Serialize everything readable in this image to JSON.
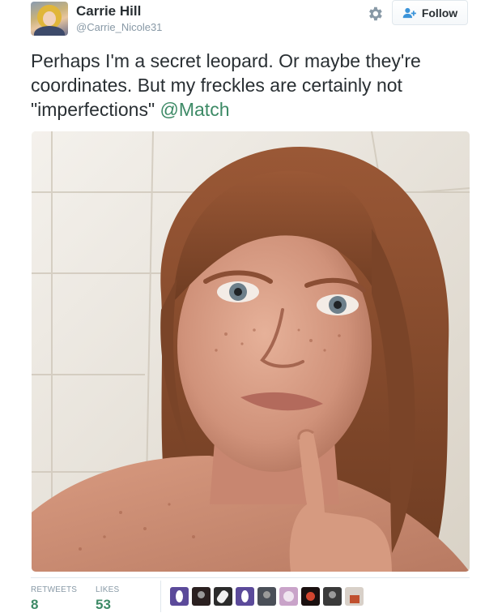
{
  "user": {
    "name": "Carrie Hill",
    "handle": "@Carrie_Nicole31"
  },
  "actions": {
    "follow_label": "Follow"
  },
  "tweet": {
    "text": "Perhaps I'm a secret leopard. Or maybe they're coordinates. But my freckles are certainly not \"imperfections\"",
    "mention": "@Match"
  },
  "stats": {
    "retweets_label": "RETWEETS",
    "retweets_count": "8",
    "likes_label": "LIKES",
    "likes_count": "53"
  },
  "likers": [
    {
      "icon": "oval-avatar-purple",
      "color": "#5b4a9a"
    },
    {
      "icon": "dark-avatar",
      "color": "#2a2020"
    },
    {
      "icon": "hand-avatar",
      "color": "#2b2b2b"
    },
    {
      "icon": "oval-avatar-purple",
      "color": "#5b4a9a"
    },
    {
      "icon": "portrait-avatar",
      "color": "#4a4f58"
    },
    {
      "icon": "pink-avatar",
      "color": "#c9a3c9"
    },
    {
      "icon": "red-glow-avatar",
      "color": "#1a1010"
    },
    {
      "icon": "dark-figure-avatar",
      "color": "#3a3a3a"
    },
    {
      "icon": "light-avatar",
      "color": "#d8d0c8"
    }
  ],
  "colors": {
    "link_green": "#3d8a66",
    "muted_gray": "#8899a6",
    "text_dark": "#292f33"
  }
}
